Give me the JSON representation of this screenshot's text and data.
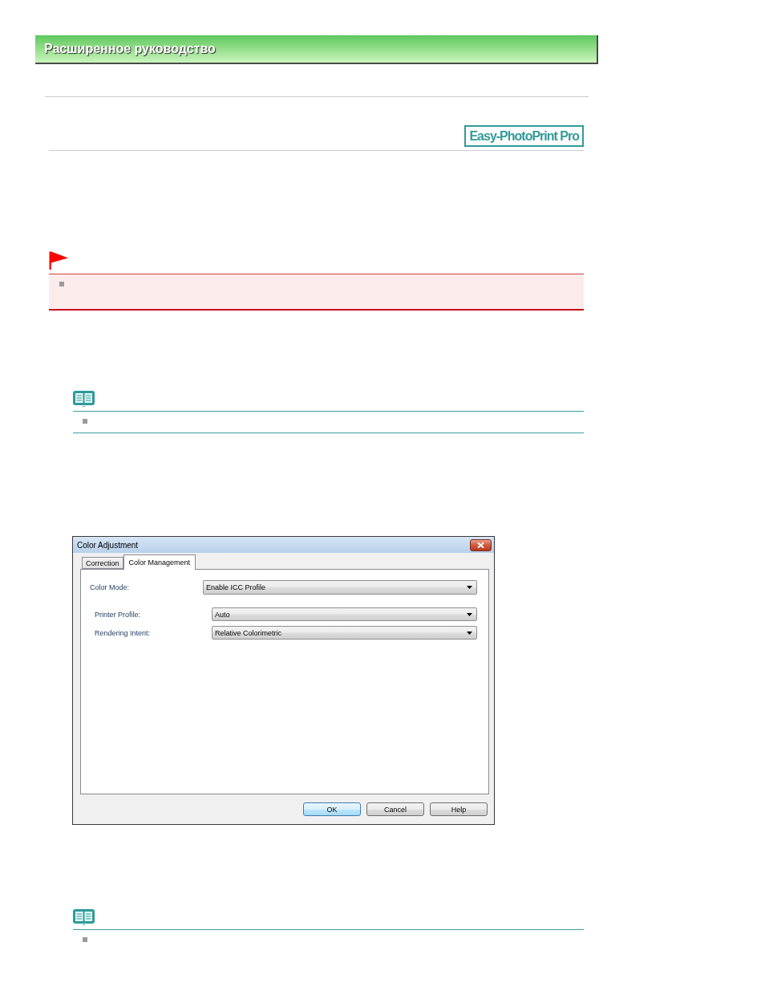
{
  "header": {
    "title": "Расширенное руководство"
  },
  "badge": {
    "label": "Easy-PhotoPrint Pro"
  },
  "blocks": [
    {
      "kind": "important",
      "items": [
        {
          "kind": "bullet"
        }
      ]
    },
    {
      "kind": "note",
      "bottom_rule": true,
      "items": [
        {
          "kind": "bullet"
        }
      ]
    },
    {
      "kind": "dialog",
      "title": "Color Adjustment",
      "tabs": [
        {
          "label": "Correction",
          "selected": false
        },
        {
          "label": "Color Management",
          "selected": true
        }
      ],
      "fields": [
        {
          "label": "Color Mode:",
          "value": "Enable ICC Profile",
          "children": [
            {
              "label": "Printer Profile:",
              "value": "Auto"
            },
            {
              "label": "Rendering Intent:",
              "value": "Relative Colorimetric"
            }
          ]
        }
      ],
      "buttons": [
        {
          "label": "OK",
          "default": true
        },
        {
          "label": "Cancel",
          "default": false
        },
        {
          "label": "Help",
          "default": false
        }
      ]
    },
    {
      "kind": "note",
      "bottom_rule": false,
      "items": [
        {
          "kind": "bullet"
        }
      ]
    }
  ]
}
